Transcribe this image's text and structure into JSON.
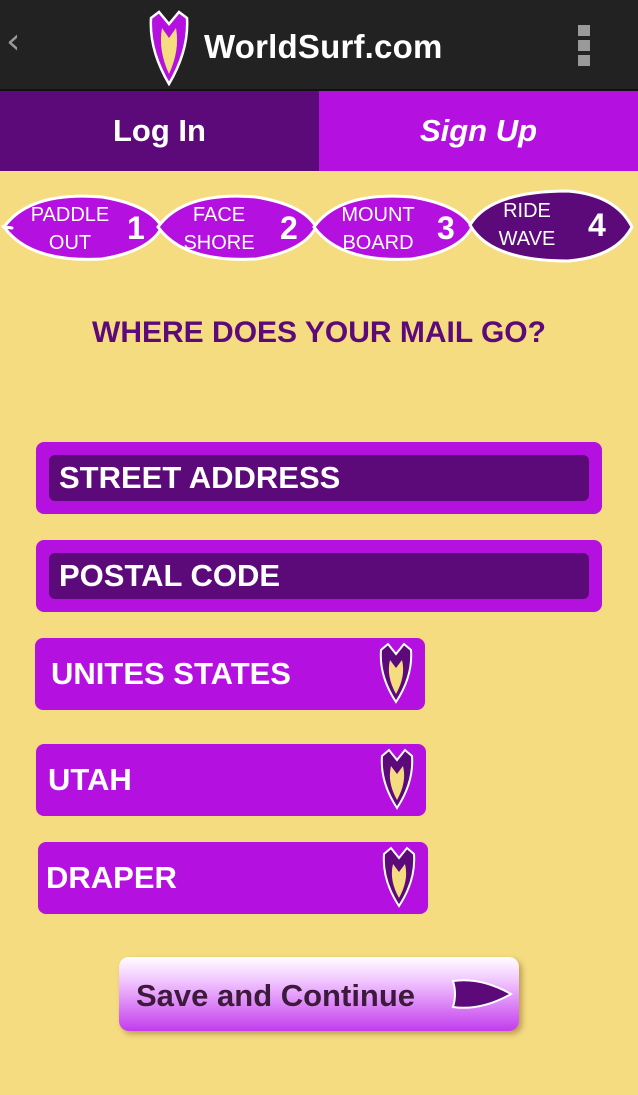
{
  "header": {
    "back_glyph": "‹",
    "brand": "WorldSurf.com",
    "logo_icon": "surfboard-logo-icon",
    "menu_icon": "overflow-menu-icon"
  },
  "tabs": {
    "login": "Log In",
    "signup": "Sign Up",
    "active": "signup"
  },
  "steps": [
    {
      "line1": "PADDLE",
      "line2": "OUT",
      "num": "1",
      "state": "done"
    },
    {
      "line1": "FACE",
      "line2": "SHORE",
      "num": "2",
      "state": "done"
    },
    {
      "line1": "MOUNT",
      "line2": "BOARD",
      "num": "3",
      "state": "done"
    },
    {
      "line1": "RIDE",
      "line2": "WAVE",
      "num": "4",
      "state": "current"
    }
  ],
  "form": {
    "heading": "WHERE DOES YOUR MAIL GO?",
    "street_placeholder": "STREET ADDRESS",
    "postal_placeholder": "POSTAL CODE",
    "country": "UNITES STATES",
    "state": "UTAH",
    "city": "DRAPER",
    "save_label": "Save and Continue"
  },
  "colors": {
    "background": "#f5dc80",
    "dark_purple": "#5c0a7a",
    "bright_purple": "#b411e0",
    "top_bar": "#222222",
    "board_yellow": "#f5dc80"
  }
}
